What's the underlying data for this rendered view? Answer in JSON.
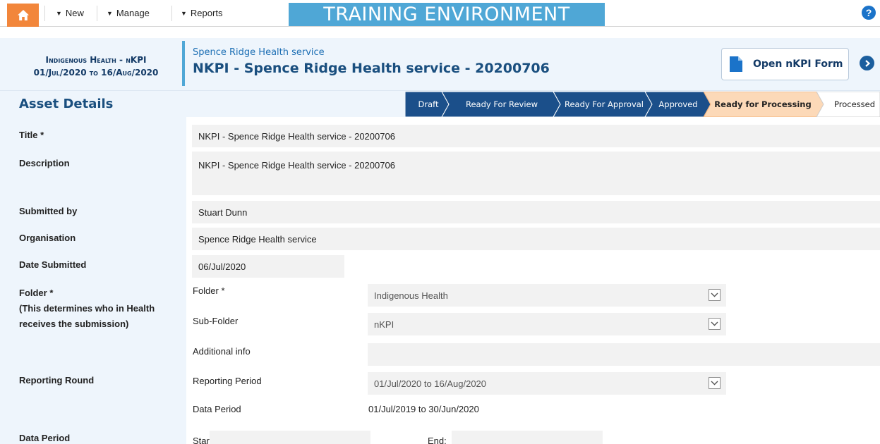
{
  "nav": {
    "home_icon": "home-icon",
    "new_label": "New",
    "manage_label": "Manage",
    "reports_label": "Reports",
    "environment_banner": "TRAINING ENVIRONMENT",
    "help_icon": "question-icon"
  },
  "header": {
    "collection_line1": "Indigenous Health - nKPI",
    "collection_line2": "01/Jul/2020 to 16/Aug/2020",
    "organisation_link": "Spence Ridge Health service",
    "asset_title": "NKPI - Spence Ridge Health service - 20200706",
    "open_form_label": "Open nKPI Form"
  },
  "section": {
    "title": "Asset Details"
  },
  "workflow": {
    "steps": [
      "Draft",
      "Ready For Review",
      "Ready For Approval",
      "Approved",
      "Ready for Processing",
      "Processed"
    ],
    "current": "Ready for Processing"
  },
  "labels": {
    "title": "Title *",
    "description": "Description",
    "submitted_by": "Submitted by",
    "organisation": "Organisation",
    "date_submitted": "Date Submitted",
    "folder": "Folder *",
    "folder_note_1": "(This determines who in Health",
    "folder_note_2": "receives the submission)",
    "reporting_round": "Reporting Round",
    "data_period": "Data Period"
  },
  "fields": {
    "title": "NKPI - Spence Ridge Health service - 20200706",
    "description": "NKPI - Spence Ridge Health service - 20200706",
    "submitted_by": "Stuart Dunn",
    "organisation": "Spence Ridge Health service",
    "date_submitted": "06/Jul/2020"
  },
  "folder": {
    "folder_label": "Folder *",
    "folder_value": "Indigenous Health",
    "subfolder_label": "Sub-Folder",
    "subfolder_value": "nKPI",
    "additional_label": "Additional info",
    "additional_value": ""
  },
  "reporting": {
    "period_label": "Reporting Period",
    "period_value": "01/Jul/2020 to 16/Aug/2020",
    "data_period_label": "Data Period",
    "data_period_value": "01/Jul/2019 to 30/Jun/2020"
  },
  "data_period": {
    "start_label": "Start:",
    "end_label": "End:"
  },
  "colors": {
    "home": "#f2863b",
    "banner": "#4fa7d6",
    "workflow_done": "#1b4f8a",
    "workflow_current": "#fcd9b8",
    "panel": "#eef5fc"
  }
}
